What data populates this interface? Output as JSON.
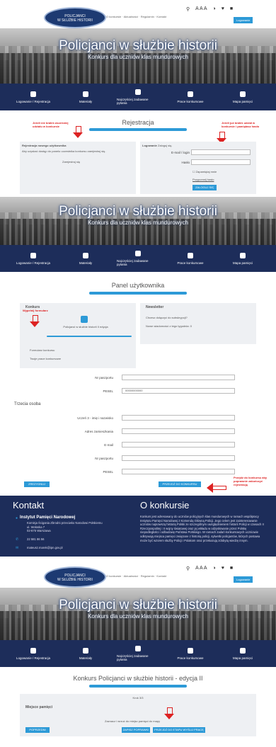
{
  "header": {
    "logo_line1": "POLICJANCI",
    "logo_line2": "W SŁUŻBIE HISTORII",
    "menu": [
      "O konkursie",
      "Aktualności",
      "Regulamin",
      "Kontakt"
    ],
    "font_sizes_label": "A A A",
    "login_button": "Logowanie"
  },
  "hero": {
    "title": "Policjanci w służbie historii",
    "subtitle": "Konkurs dla uczniów klas mundurowych"
  },
  "nav": [
    {
      "label": "Logowanie / Rejestracja",
      "icon": "users-icon"
    },
    {
      "label": "Materiały",
      "icon": "document-icon"
    },
    {
      "label": "Najczęściej zadawane pytania",
      "icon": "question-bubble-icon"
    },
    {
      "label": "Prace konkursowe",
      "icon": "briefcase-icon"
    },
    {
      "label": "Mapa pamięci",
      "icon": "map-pin-icon"
    }
  ],
  "registration": {
    "title": "Rejestracja",
    "note_left": "Jeżeli nie brałeś wcześniej udziału w konkursie",
    "note_right": "Jeżeli już brałeś udział w konkursie i pamiętasz hasło",
    "new_user_heading": "Rejestracja nowego użytkownika",
    "new_user_desc": "Aby uzyskać dostęp do panelu uczestnika konkursu zarejestruj się.",
    "register_link": "Zarejestruj się",
    "existing_heading": "Logowanie",
    "existing_desc": "Zaloguj się.",
    "email_label": "E-mail / login",
    "password_label": "Hasło",
    "remember_label": "Zapamiętaj mnie",
    "forgot_link": "Przypomnij hasło",
    "login_button": "ZALOGUJ SIĘ"
  },
  "panel": {
    "title": "Panel użytkownika",
    "contest_heading": "Konkurs",
    "fill_form_note": "Wypełnij formularz",
    "contest_item": "Policjanci w służbie historii II edycja",
    "form_link": "Formularz konkursu",
    "works_link": "Twoje prace konkursowe",
    "newsletter_heading": "Newsletter",
    "newsletter_text": "Chcesz dołączyć do subskrypcji?",
    "newsletter_text2": "Nowe wiadomości z tego tygodnia: 0"
  },
  "form": {
    "passport_label": "Nr paszportu",
    "pesel_label": "PESEL",
    "pesel_value": "00000000000",
    "third_person": "Trzecia osoba",
    "name_label": "Uczeń 3 - imię i nazwisko",
    "address_label": "Adres zamieszkania",
    "email_label": "E-mail",
    "passport_label2": "Nr paszportu",
    "pesel_label2": "PESEL",
    "cancel_button": "ZREZYGNUJ",
    "continue_button": "PRZEJDŹ DO KONKURSU",
    "continue_note": "Przejdź do konkursu aby poprawnie zakończyć rejestrację"
  },
  "footer": {
    "contact_heading": "Kontakt",
    "org_name": "Instytut Pamięci Narodowej",
    "org_desc": "Komisja Ścigania Zbrodni przeciwko Narodowi Polskiemu",
    "street": "ul. Wołoska 7",
    "city": "02-675 Warszawa",
    "phone": "22 581 86 56",
    "email": "mateusz.marek@ipn.gov.pl",
    "about_heading": "O konkursie",
    "about_text": "Konkurs jest adresowany do uczniów policyjnych klas mundurowych w ramach współpracy Instytutu Pamięci Narodowej z Komendą Główną Policji. Jego celem jest zainteresowanie uczniów najnowszą historią Polski ze szczególnym uwzględnieniem historii Policji w czasach II Rzeczpospolitej i II wojny światowej oraz jej wkładu w odzyskiwanie przez Polskę niepodległości i odbudowę Państwa Polskiego. W ramach zadań konkursowych uczniowie odkrywają miejsca pamięci związane z historią policji, sylwetki policjantów, których postawa może być wzorem służby Policji i Polakom oraz przekazują zdobytą wiedzę innym."
  },
  "edition": {
    "title": "Konkurs Policjanci w służbie historii - edycja II",
    "step": "Krok 3/3",
    "places_heading": "Miejsce pamięci",
    "note": "Zaznacz i wrzuć do miejsc pamięci do mapy",
    "prev_button": "POPRZEDNI",
    "save_button": "ZAPISZ POPRAWKI",
    "next_button": "PRZEJDŹ DO ETAPU WYŚLIJ PRACĘ"
  },
  "colors": {
    "navy": "#1d2d5a",
    "accent": "#2d9ad7",
    "annotation": "#dd2222"
  }
}
